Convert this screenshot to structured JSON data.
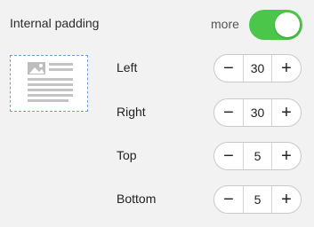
{
  "header": {
    "title": "Internal padding",
    "more_label": "more",
    "toggle_on": true,
    "toggle_color": "#4cc64a"
  },
  "preview": {
    "icon": "document-with-image-icon",
    "border_color": "#6f9ed8"
  },
  "rows": [
    {
      "label": "Left",
      "value": "30",
      "minus": "−",
      "plus": "+"
    },
    {
      "label": "Right",
      "value": "30",
      "minus": "−",
      "plus": "+"
    },
    {
      "label": "Top",
      "value": "5",
      "minus": "−",
      "plus": "+"
    },
    {
      "label": "Bottom",
      "value": "5",
      "minus": "−",
      "plus": "+"
    }
  ]
}
